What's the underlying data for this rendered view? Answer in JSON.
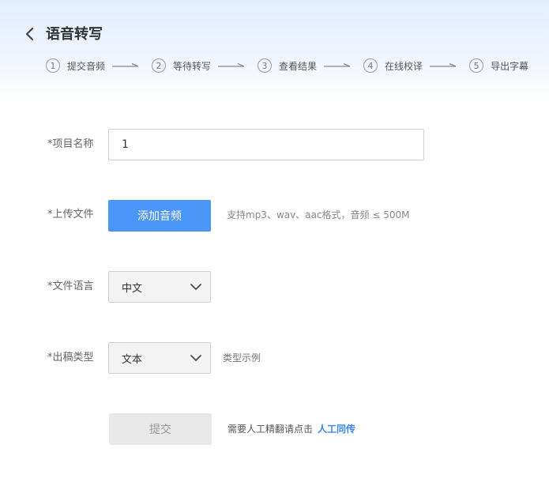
{
  "header": {
    "title": "语音转写",
    "back_icon": "chevron-left-icon"
  },
  "steps": [
    {
      "num": "1",
      "label": "提交音频"
    },
    {
      "num": "2",
      "label": "等待转写"
    },
    {
      "num": "3",
      "label": "查看结果"
    },
    {
      "num": "4",
      "label": "在线校译"
    },
    {
      "num": "5",
      "label": "导出字幕"
    }
  ],
  "form": {
    "project_name": {
      "label": "*项目名称",
      "value": "1"
    },
    "upload": {
      "label": "*上传文件",
      "button_label": "添加音频",
      "hint": "支持mp3、wav、aac格式，音频 ≤ 500M"
    },
    "language": {
      "label": "*文件语言",
      "selected": "中文"
    },
    "output_type": {
      "label": "*出稿类型",
      "selected": "文本",
      "example_link": "类型示例"
    },
    "submit": {
      "label": "提交",
      "hint": "需要人工精翻请点击",
      "link": "人工同传"
    }
  },
  "colors": {
    "primary": "#4b96f9",
    "link": "#3a85f0",
    "header_gradient_top": "#e3effd"
  }
}
